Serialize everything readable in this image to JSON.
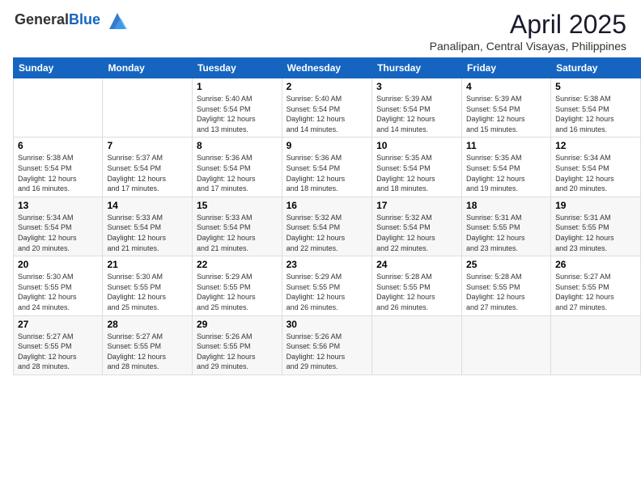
{
  "header": {
    "logo_general": "General",
    "logo_blue": "Blue",
    "month_title": "April 2025",
    "location": "Panalipan, Central Visayas, Philippines"
  },
  "days_of_week": [
    "Sunday",
    "Monday",
    "Tuesday",
    "Wednesday",
    "Thursday",
    "Friday",
    "Saturday"
  ],
  "weeks": [
    [
      {
        "num": "",
        "info": ""
      },
      {
        "num": "",
        "info": ""
      },
      {
        "num": "1",
        "info": "Sunrise: 5:40 AM\nSunset: 5:54 PM\nDaylight: 12 hours\nand 13 minutes."
      },
      {
        "num": "2",
        "info": "Sunrise: 5:40 AM\nSunset: 5:54 PM\nDaylight: 12 hours\nand 14 minutes."
      },
      {
        "num": "3",
        "info": "Sunrise: 5:39 AM\nSunset: 5:54 PM\nDaylight: 12 hours\nand 14 minutes."
      },
      {
        "num": "4",
        "info": "Sunrise: 5:39 AM\nSunset: 5:54 PM\nDaylight: 12 hours\nand 15 minutes."
      },
      {
        "num": "5",
        "info": "Sunrise: 5:38 AM\nSunset: 5:54 PM\nDaylight: 12 hours\nand 16 minutes."
      }
    ],
    [
      {
        "num": "6",
        "info": "Sunrise: 5:38 AM\nSunset: 5:54 PM\nDaylight: 12 hours\nand 16 minutes."
      },
      {
        "num": "7",
        "info": "Sunrise: 5:37 AM\nSunset: 5:54 PM\nDaylight: 12 hours\nand 17 minutes."
      },
      {
        "num": "8",
        "info": "Sunrise: 5:36 AM\nSunset: 5:54 PM\nDaylight: 12 hours\nand 17 minutes."
      },
      {
        "num": "9",
        "info": "Sunrise: 5:36 AM\nSunset: 5:54 PM\nDaylight: 12 hours\nand 18 minutes."
      },
      {
        "num": "10",
        "info": "Sunrise: 5:35 AM\nSunset: 5:54 PM\nDaylight: 12 hours\nand 18 minutes."
      },
      {
        "num": "11",
        "info": "Sunrise: 5:35 AM\nSunset: 5:54 PM\nDaylight: 12 hours\nand 19 minutes."
      },
      {
        "num": "12",
        "info": "Sunrise: 5:34 AM\nSunset: 5:54 PM\nDaylight: 12 hours\nand 20 minutes."
      }
    ],
    [
      {
        "num": "13",
        "info": "Sunrise: 5:34 AM\nSunset: 5:54 PM\nDaylight: 12 hours\nand 20 minutes."
      },
      {
        "num": "14",
        "info": "Sunrise: 5:33 AM\nSunset: 5:54 PM\nDaylight: 12 hours\nand 21 minutes."
      },
      {
        "num": "15",
        "info": "Sunrise: 5:33 AM\nSunset: 5:54 PM\nDaylight: 12 hours\nand 21 minutes."
      },
      {
        "num": "16",
        "info": "Sunrise: 5:32 AM\nSunset: 5:54 PM\nDaylight: 12 hours\nand 22 minutes."
      },
      {
        "num": "17",
        "info": "Sunrise: 5:32 AM\nSunset: 5:54 PM\nDaylight: 12 hours\nand 22 minutes."
      },
      {
        "num": "18",
        "info": "Sunrise: 5:31 AM\nSunset: 5:55 PM\nDaylight: 12 hours\nand 23 minutes."
      },
      {
        "num": "19",
        "info": "Sunrise: 5:31 AM\nSunset: 5:55 PM\nDaylight: 12 hours\nand 23 minutes."
      }
    ],
    [
      {
        "num": "20",
        "info": "Sunrise: 5:30 AM\nSunset: 5:55 PM\nDaylight: 12 hours\nand 24 minutes."
      },
      {
        "num": "21",
        "info": "Sunrise: 5:30 AM\nSunset: 5:55 PM\nDaylight: 12 hours\nand 25 minutes."
      },
      {
        "num": "22",
        "info": "Sunrise: 5:29 AM\nSunset: 5:55 PM\nDaylight: 12 hours\nand 25 minutes."
      },
      {
        "num": "23",
        "info": "Sunrise: 5:29 AM\nSunset: 5:55 PM\nDaylight: 12 hours\nand 26 minutes."
      },
      {
        "num": "24",
        "info": "Sunrise: 5:28 AM\nSunset: 5:55 PM\nDaylight: 12 hours\nand 26 minutes."
      },
      {
        "num": "25",
        "info": "Sunrise: 5:28 AM\nSunset: 5:55 PM\nDaylight: 12 hours\nand 27 minutes."
      },
      {
        "num": "26",
        "info": "Sunrise: 5:27 AM\nSunset: 5:55 PM\nDaylight: 12 hours\nand 27 minutes."
      }
    ],
    [
      {
        "num": "27",
        "info": "Sunrise: 5:27 AM\nSunset: 5:55 PM\nDaylight: 12 hours\nand 28 minutes."
      },
      {
        "num": "28",
        "info": "Sunrise: 5:27 AM\nSunset: 5:55 PM\nDaylight: 12 hours\nand 28 minutes."
      },
      {
        "num": "29",
        "info": "Sunrise: 5:26 AM\nSunset: 5:55 PM\nDaylight: 12 hours\nand 29 minutes."
      },
      {
        "num": "30",
        "info": "Sunrise: 5:26 AM\nSunset: 5:56 PM\nDaylight: 12 hours\nand 29 minutes."
      },
      {
        "num": "",
        "info": ""
      },
      {
        "num": "",
        "info": ""
      },
      {
        "num": "",
        "info": ""
      }
    ]
  ]
}
